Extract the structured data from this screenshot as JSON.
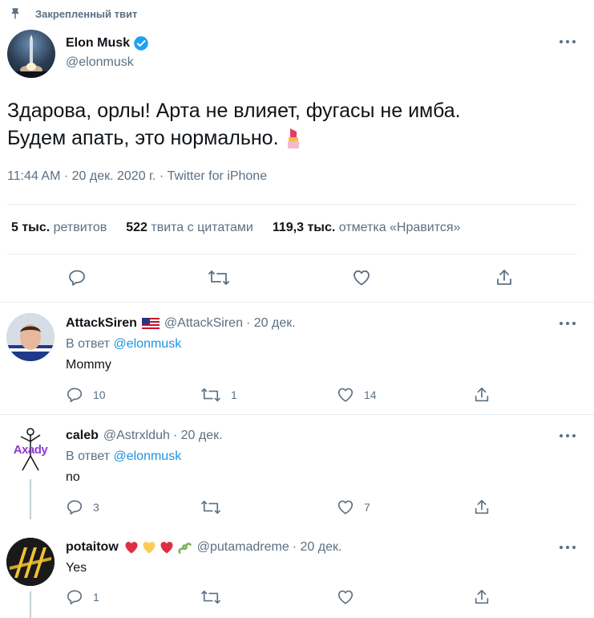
{
  "pinned_label": "Закрепленный твит",
  "main_tweet": {
    "author_name": "Elon Musk",
    "handle": "@elonmusk",
    "text_line1": "Здарова, орлы! Арта не влияет, фугасы не имба.",
    "text_line2": "Будем апать, это нормально.",
    "emoji": "lipstick",
    "meta": "11:44 AM · 20 дек. 2020 г. · Twitter for iPhone",
    "stats": [
      {
        "value": "5 тыс.",
        "label": "ретвитов"
      },
      {
        "value": "522",
        "label": "твита с цитатами"
      },
      {
        "value": "119,3 тыс.",
        "label": "отметка «Нравится»"
      }
    ]
  },
  "replies": [
    {
      "author_name": "AttackSiren",
      "flag": "us-flag",
      "handle": "@AttackSiren",
      "date": "· 20 дек.",
      "reply_to_prefix": "В ответ",
      "reply_to_handle": "@elonmusk",
      "text": "Mommy",
      "reply_count": "10",
      "retweet_count": "1",
      "like_count": "14"
    },
    {
      "author_name": "caleb",
      "handle": "@Astrxlduh",
      "date": "· 20 дек.",
      "reply_to_prefix": "В ответ",
      "reply_to_handle": "@elonmusk",
      "text": "no",
      "avatar_text": "Axady",
      "reply_count": "3",
      "retweet_count": "",
      "like_count": "7"
    },
    {
      "author_name": "potaitow",
      "badges": [
        "red-heart",
        "yellow-heart",
        "red-heart",
        "green-snake"
      ],
      "handle": "@putamadreme",
      "date": "· 20 дек.",
      "text": "Yes",
      "reply_count": "1",
      "retweet_count": "",
      "like_count": ""
    }
  ],
  "colors": {
    "accent": "#1da1f2",
    "link": "#1b95e0",
    "secondary_text": "#5b7083",
    "divider": "#e6ecf0"
  }
}
